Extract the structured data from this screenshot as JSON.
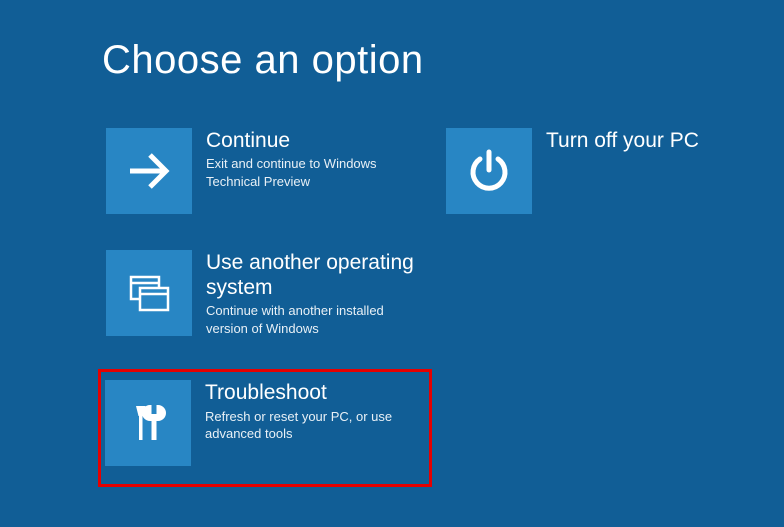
{
  "title": "Choose an option",
  "colors": {
    "background": "#115e96",
    "tile": "#2886c4",
    "highlight": "#e60000"
  },
  "options": {
    "continue": {
      "title": "Continue",
      "desc": "Exit and continue to Windows Technical Preview"
    },
    "use_another_os": {
      "title": "Use another operating system",
      "desc": "Continue with another installed version of Windows"
    },
    "troubleshoot": {
      "title": "Troubleshoot",
      "desc": "Refresh or reset your PC, or use advanced tools"
    },
    "turn_off": {
      "title": "Turn off your PC",
      "desc": ""
    }
  }
}
